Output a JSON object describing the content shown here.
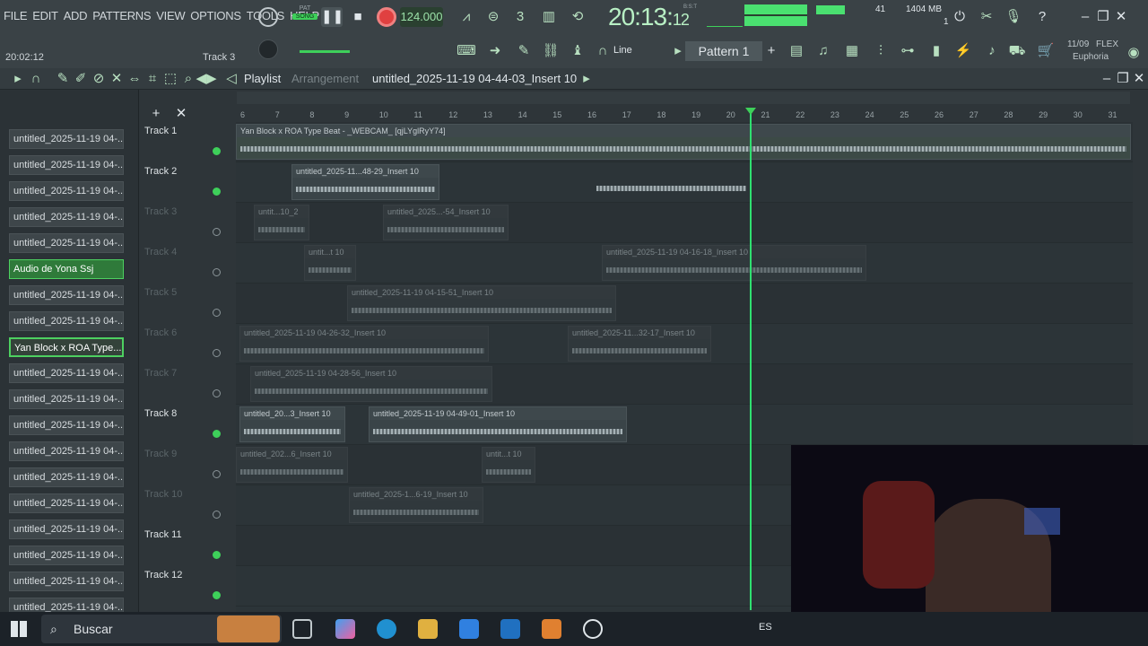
{
  "menu": [
    "FILE",
    "EDIT",
    "ADD",
    "PATTERNS",
    "VIEW",
    "OPTIONS",
    "TOOLS",
    "HELP"
  ],
  "transport": {
    "mode_top": "PAT",
    "mode_bottom": "SONG",
    "tempo": "124.000",
    "clock_main": "20:13:",
    "clock_small": "12",
    "clock_label": "B:S:T",
    "cpu": "41",
    "mem": "1404 MB",
    "voices": "1",
    "date": "11/09",
    "plugin_name": "FLEX",
    "preset": "Euphoria"
  },
  "hint": {
    "position": "20:02:12",
    "track": "Track 3"
  },
  "toolbar2": {
    "snap": "Line",
    "pattern": "Pattern 1"
  },
  "playlist": {
    "title": "Playlist",
    "subtitle": "Arrangement",
    "path": "untitled_2025-11-19 04-44-03_Insert 10"
  },
  "ruler": [
    "6",
    "7",
    "8",
    "9",
    "10",
    "11",
    "12",
    "13",
    "14",
    "15",
    "16",
    "17",
    "18",
    "19",
    "20",
    "21",
    "22",
    "23",
    "24",
    "25",
    "26",
    "27",
    "28",
    "29",
    "30",
    "31"
  ],
  "browser": [
    {
      "label": "untitled_2025-11-19 04-..."
    },
    {
      "label": "untitled_2025-11-19 04-..."
    },
    {
      "label": "untitled_2025-11-19 04-..."
    },
    {
      "label": "untitled_2025-11-19 04-..."
    },
    {
      "label": "untitled_2025-11-19 04-..."
    },
    {
      "label": "Audio de Yona Ssj"
    },
    {
      "label": "untitled_2025-11-19 04-..."
    },
    {
      "label": "untitled_2025-11-19 04-..."
    },
    {
      "label": "Yan Block x ROA Type..."
    },
    {
      "label": "untitled_2025-11-19 04-..."
    },
    {
      "label": "untitled_2025-11-19 04-..."
    },
    {
      "label": "untitled_2025-11-19 04-..."
    },
    {
      "label": "untitled_2025-11-19 04-..."
    },
    {
      "label": "untitled_2025-11-19 04-..."
    },
    {
      "label": "untitled_2025-11-19 04-..."
    },
    {
      "label": "untitled_2025-11-19 04-..."
    },
    {
      "label": "untitled_2025-11-19 04-..."
    },
    {
      "label": "untitled_2025-11-19 04-..."
    },
    {
      "label": "untitled_2025-11-19 04-..."
    }
  ],
  "tracks": [
    {
      "label": "Track 1",
      "active": true
    },
    {
      "label": "Track 2",
      "active": true
    },
    {
      "label": "Track 3",
      "active": false
    },
    {
      "label": "Track 4",
      "active": false
    },
    {
      "label": "Track 5",
      "active": false
    },
    {
      "label": "Track 6",
      "active": false
    },
    {
      "label": "Track 7",
      "active": false
    },
    {
      "label": "Track 8",
      "active": true
    },
    {
      "label": "Track 9",
      "active": false
    },
    {
      "label": "Track 10",
      "active": false
    },
    {
      "label": "Track 11",
      "active": true
    },
    {
      "label": "Track 12",
      "active": true
    }
  ],
  "clips": [
    {
      "track": 0,
      "title": "Yan Block x ROA Type Beat - _WEBCAM_ [qjLYglRyY74]"
    },
    {
      "track": 1,
      "title": "untitled_2025-11...48-29_Insert 10"
    },
    {
      "track": 1,
      "title": ""
    },
    {
      "track": 2,
      "title": "untit...10_2"
    },
    {
      "track": 2,
      "title": "untitled_2025...-54_Insert 10"
    },
    {
      "track": 3,
      "title": "untit...t 10"
    },
    {
      "track": 3,
      "title": "untitled_2025-11-19 04-16-18_Insert 10"
    },
    {
      "track": 4,
      "title": "untitled_2025-11-19 04-15-51_Insert 10"
    },
    {
      "track": 5,
      "title": "untitled_2025-11-19 04-26-32_Insert 10"
    },
    {
      "track": 5,
      "title": "untitled_2025-11...32-17_Insert 10"
    },
    {
      "track": 6,
      "title": "untitled_2025-11-19 04-28-56_Insert 10"
    },
    {
      "track": 7,
      "title": "untitled_20...3_Insert 10"
    },
    {
      "track": 7,
      "title": "untitled_2025-11-19 04-49-01_Insert 10"
    },
    {
      "track": 8,
      "title": "untitled_202...6_Insert 10"
    },
    {
      "track": 8,
      "title": "untit...t 10"
    },
    {
      "track": 9,
      "title": "untitled_2025-1...6-19_Insert 10"
    }
  ],
  "taskbar": {
    "search_placeholder": "Buscar",
    "lang": "ES"
  },
  "colors": {
    "accent": "#3ed05a",
    "bg": "#2e3539"
  }
}
